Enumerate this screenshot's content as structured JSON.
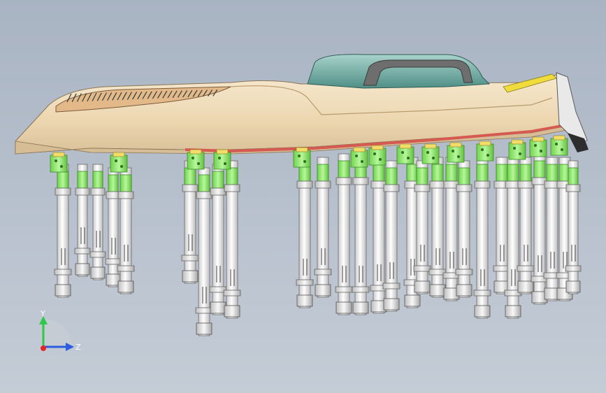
{
  "viewport": {
    "background_top": "#a9b4c3",
    "background_bottom": "#c4ccd6"
  },
  "model": {
    "panel_fill": "#f1dfbf",
    "panel_shade": "#d9c19a",
    "handle_fill": "#7fb5ac",
    "handle_dark": "#3b6f69",
    "bracket_green": "#8fe86a",
    "pin_fill": "#f2f2f2",
    "pin_stroke": "#6b6b6b",
    "red_rim": "#d45a52",
    "yellow_edge": "#f0dc3c"
  },
  "triad": {
    "y_label": "Y",
    "z_label": "Z",
    "y_color": "#2fc84a",
    "z_color": "#2a5de0",
    "origin_color": "#e02828"
  }
}
